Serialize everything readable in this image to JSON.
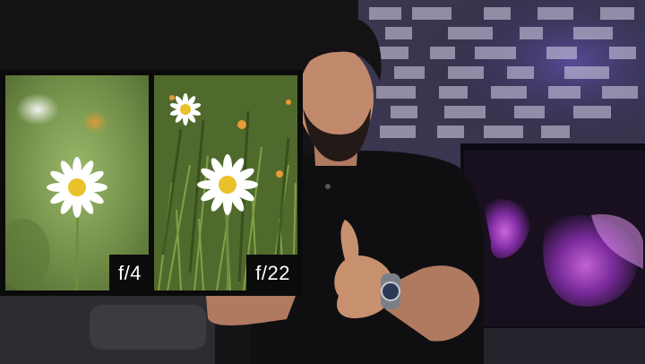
{
  "comparison": {
    "left": {
      "aperture_label": "f/4"
    },
    "right": {
      "aperture_label": "f/22"
    }
  },
  "palette": {
    "background": "#141417",
    "tv_glow": "#c04ad8",
    "backlight": "#7a5cff",
    "label_bg": "#0b0b0b",
    "label_text": "#ffffff"
  }
}
